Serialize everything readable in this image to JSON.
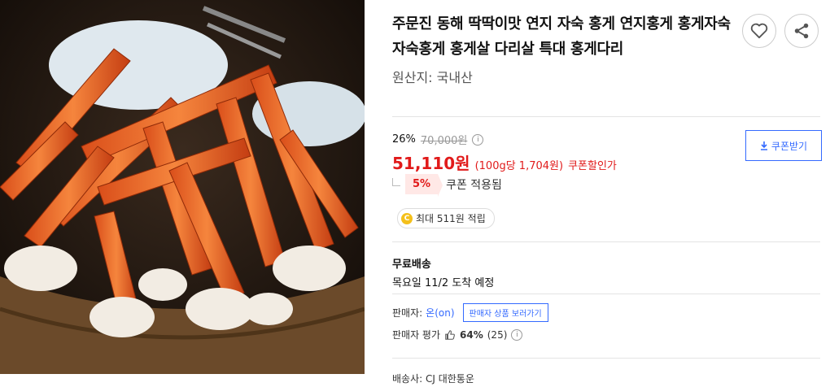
{
  "product": {
    "title": "주문진 동해 딱딱이맛 연지 자숙 홍게 연지홍게 홍게자숙 자숙홍게 홍게살 다리살 특대 홍게다리",
    "origin": "원산지: 국내산"
  },
  "actions": {
    "like_icon": "heart-icon",
    "share_icon": "share-icon"
  },
  "price": {
    "discount_rate": "26%",
    "original": "70,000원",
    "sale": "51,110원",
    "unit_price": "(100g당 1,704원)",
    "coupon_label": "쿠폰할인가",
    "coupon_button": "쿠폰받기"
  },
  "coupon": {
    "percent": "5%",
    "status": "쿠폰 적용됨"
  },
  "reward": {
    "coin": "C",
    "text": "최대 511원 적립"
  },
  "shipping": {
    "title": "무료배송",
    "arrival": "목요일 11/2 도착 예정"
  },
  "seller": {
    "label": "판매자:",
    "name": "온(on)",
    "button": "판매자 상품 보러가기",
    "rating_label": "판매자 평가",
    "rating_pct": "64%",
    "rating_count": "(25)"
  },
  "courier": "배송사: CJ 대한통운",
  "colors": {
    "accent": "#346aff",
    "price": "#e11a1a"
  }
}
